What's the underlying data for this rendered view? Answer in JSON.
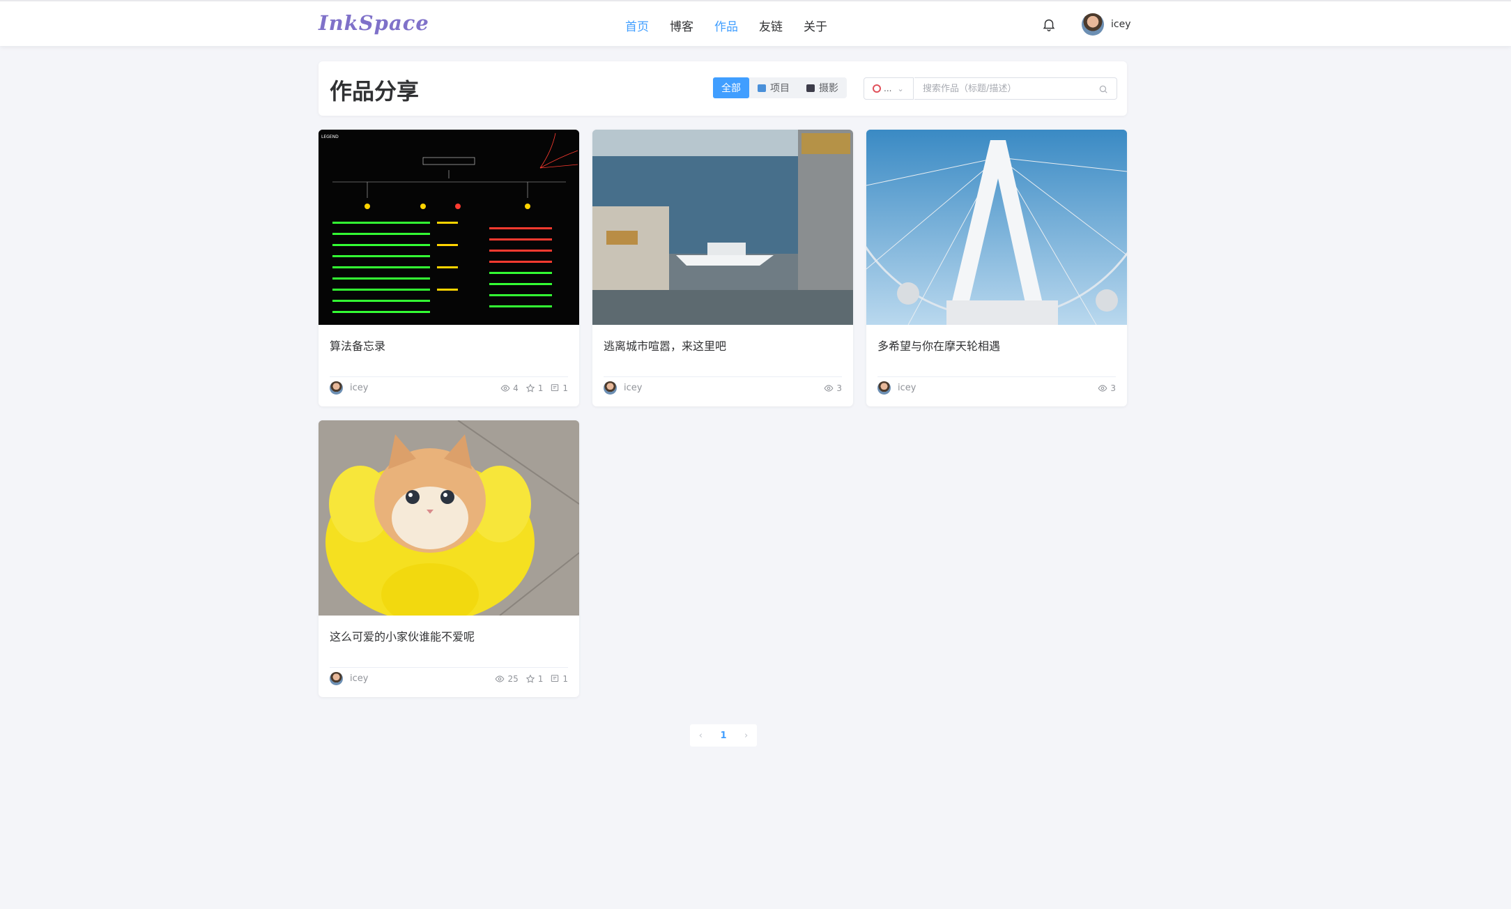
{
  "header": {
    "logo": "InkSpace",
    "nav": [
      "首页",
      "博客",
      "作品",
      "友链",
      "关于"
    ],
    "user_name": "icey",
    "icons": {
      "notifications": "bell-icon",
      "avatar": "user-avatar"
    }
  },
  "toolbar": {
    "title": "作品分享",
    "filters": [
      "全部",
      "项目",
      "摄影"
    ],
    "active_filter": "全部",
    "sort_label": "...",
    "search_placeholder": "搜索作品（标题/描述）"
  },
  "works": [
    {
      "title": "算法备忘录",
      "author": "icey",
      "views": "4",
      "likes": "1",
      "comments": "1"
    },
    {
      "title": "逃离城市喧嚣，来这里吧",
      "author": "icey",
      "views": "3"
    },
    {
      "title": "多希望与你在摩天轮相遇",
      "author": "icey",
      "views": "3"
    },
    {
      "title": "这么可爱的小家伙谁能不爱呢",
      "author": "icey",
      "views": "25",
      "likes": "1",
      "comments": "1"
    }
  ],
  "pagination": {
    "current": "1",
    "prev": "‹",
    "next": "›"
  },
  "colors": {
    "accent": "#409eff",
    "logo": "#7f71c9",
    "background": "#f4f5f9"
  }
}
